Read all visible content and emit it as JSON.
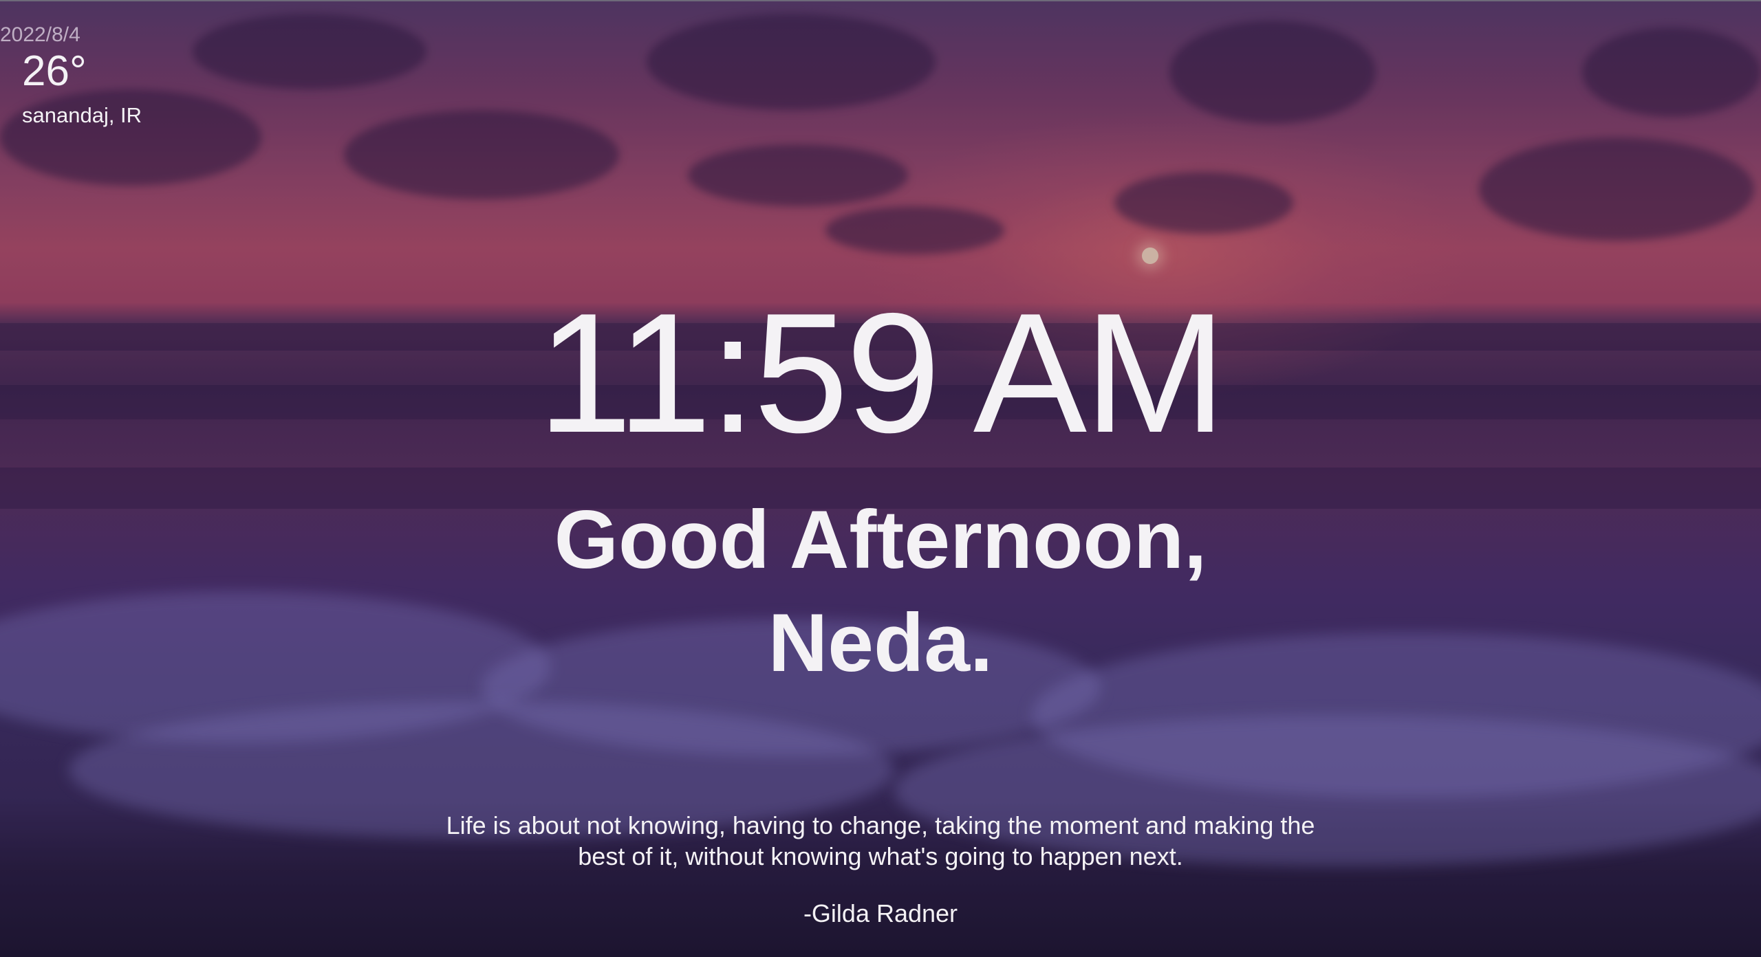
{
  "weather": {
    "date": "2022/8/4",
    "temperature": "26°",
    "location": "sanandaj, IR"
  },
  "clock": {
    "time": "11:59 AM"
  },
  "greeting": {
    "line1": "Good Afternoon,",
    "line2": "Neda."
  },
  "quote": {
    "text": "Life is about not knowing, having to change, taking the moment and making the best of it, without knowing what's going to happen next.",
    "author": "-Gilda Radner"
  },
  "colors": {
    "text": "#f4f2f5",
    "sky_top": "#5a3d6e",
    "horizon": "#b14f6c",
    "sea": "#3f3168"
  }
}
